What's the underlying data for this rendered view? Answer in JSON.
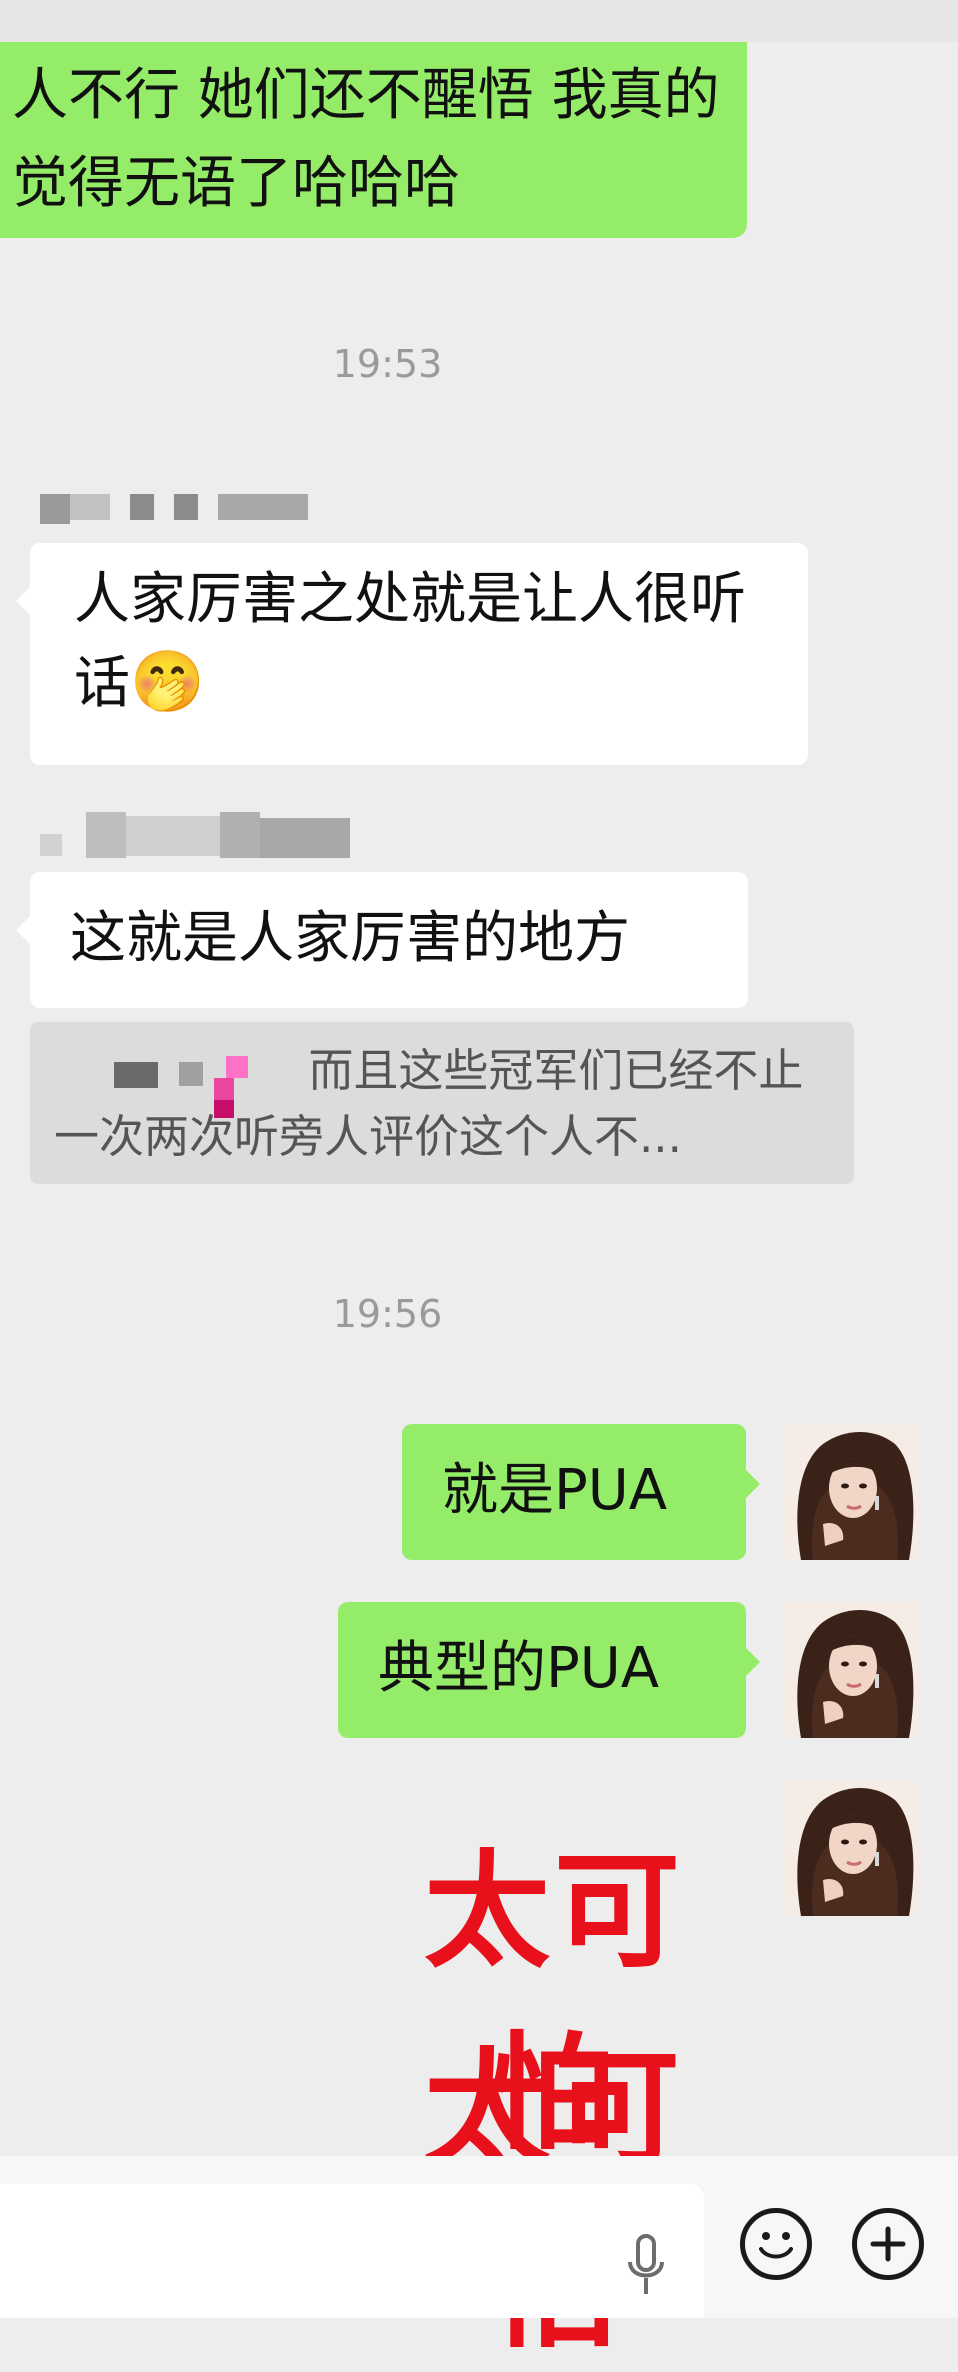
{
  "messages": {
    "first": "人不行  她们还不醒悟 我真的觉得无语了哈哈哈",
    "time1": "19:53",
    "reply1": "人家厉害之处就是让人很听话",
    "reply1_emoji": "🤭",
    "reply2": "这就是人家厉害的地方",
    "quote": "而且这些冠军们已经不止一次两次听旁人评价这个人不...",
    "time2": "19:56",
    "mine1": "就是PUA",
    "mine2": "典型的PUA",
    "big1": "太可怕",
    "big2": "太可怕"
  },
  "icons": {
    "voice": "microphone-icon",
    "emoji": "smiley-icon",
    "more": "plus-icon"
  },
  "colors": {
    "green_bubble": "#95ec69",
    "white_bubble": "#ffffff",
    "background": "#ededed",
    "big_text": "#e8101a"
  }
}
